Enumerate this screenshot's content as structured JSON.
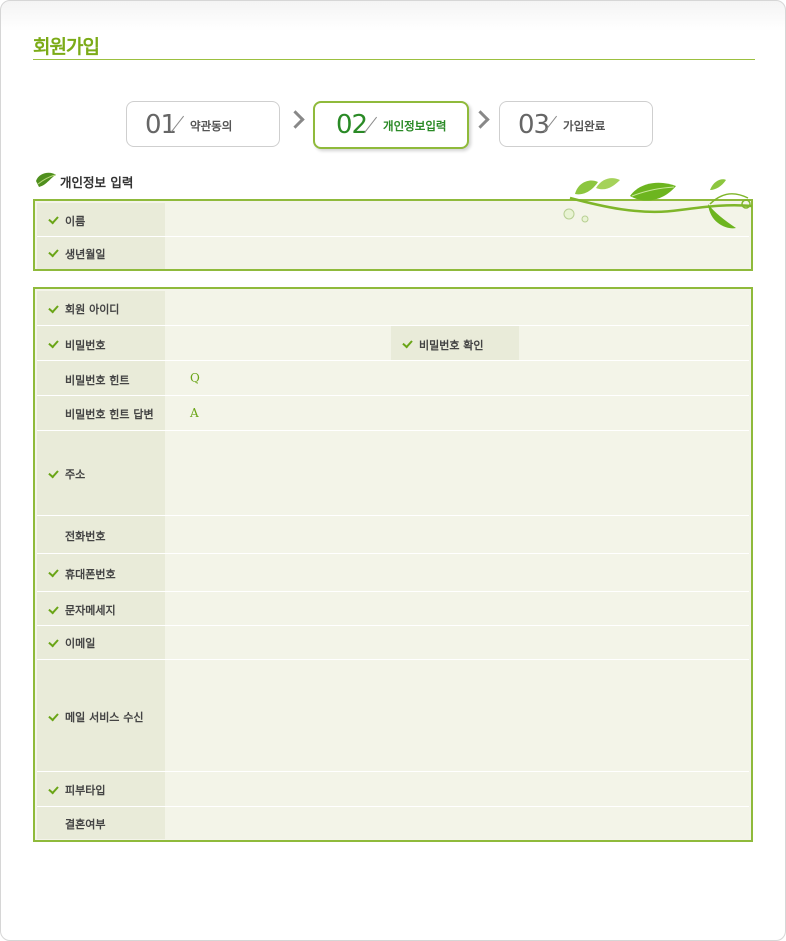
{
  "page": {
    "title": "회원가입"
  },
  "steps": [
    {
      "num": "01",
      "label": "약관동의",
      "active": false
    },
    {
      "num": "02",
      "label": "개인정보입력",
      "active": true
    },
    {
      "num": "03",
      "label": "가입완료",
      "active": false
    }
  ],
  "section": {
    "heading": "개인정보 입력"
  },
  "table1": {
    "rows": [
      {
        "label": "이름",
        "required": true
      },
      {
        "label": "생년월일",
        "required": true
      }
    ]
  },
  "table2": {
    "rows": [
      {
        "label": "회원 아이디",
        "required": true
      },
      {
        "label": "비밀번호",
        "required": true,
        "inline_label": "비밀번호 확인"
      },
      {
        "label": "비밀번호 힌트",
        "required": false,
        "mark": "Q"
      },
      {
        "label": "비밀번호 힌트 답변",
        "required": false,
        "mark": "A"
      },
      {
        "label": "주소",
        "required": true
      },
      {
        "label": "전화번호",
        "required": false
      },
      {
        "label": "휴대폰번호",
        "required": true
      },
      {
        "label": "문자메세지",
        "required": true
      },
      {
        "label": "이메일",
        "required": true
      },
      {
        "label": "메일 서비스 수신",
        "required": true
      },
      {
        "label": "피부타입",
        "required": true
      },
      {
        "label": "결혼여부",
        "required": false
      }
    ]
  },
  "colors": {
    "accent": "#7bab17",
    "border": "#8fba3b",
    "label_bg": "#e9ebd9",
    "value_bg": "#f3f4e8"
  },
  "icons": {
    "required": "check-icon",
    "section": "leaf-icon",
    "separator": "chevron-right-icon"
  }
}
